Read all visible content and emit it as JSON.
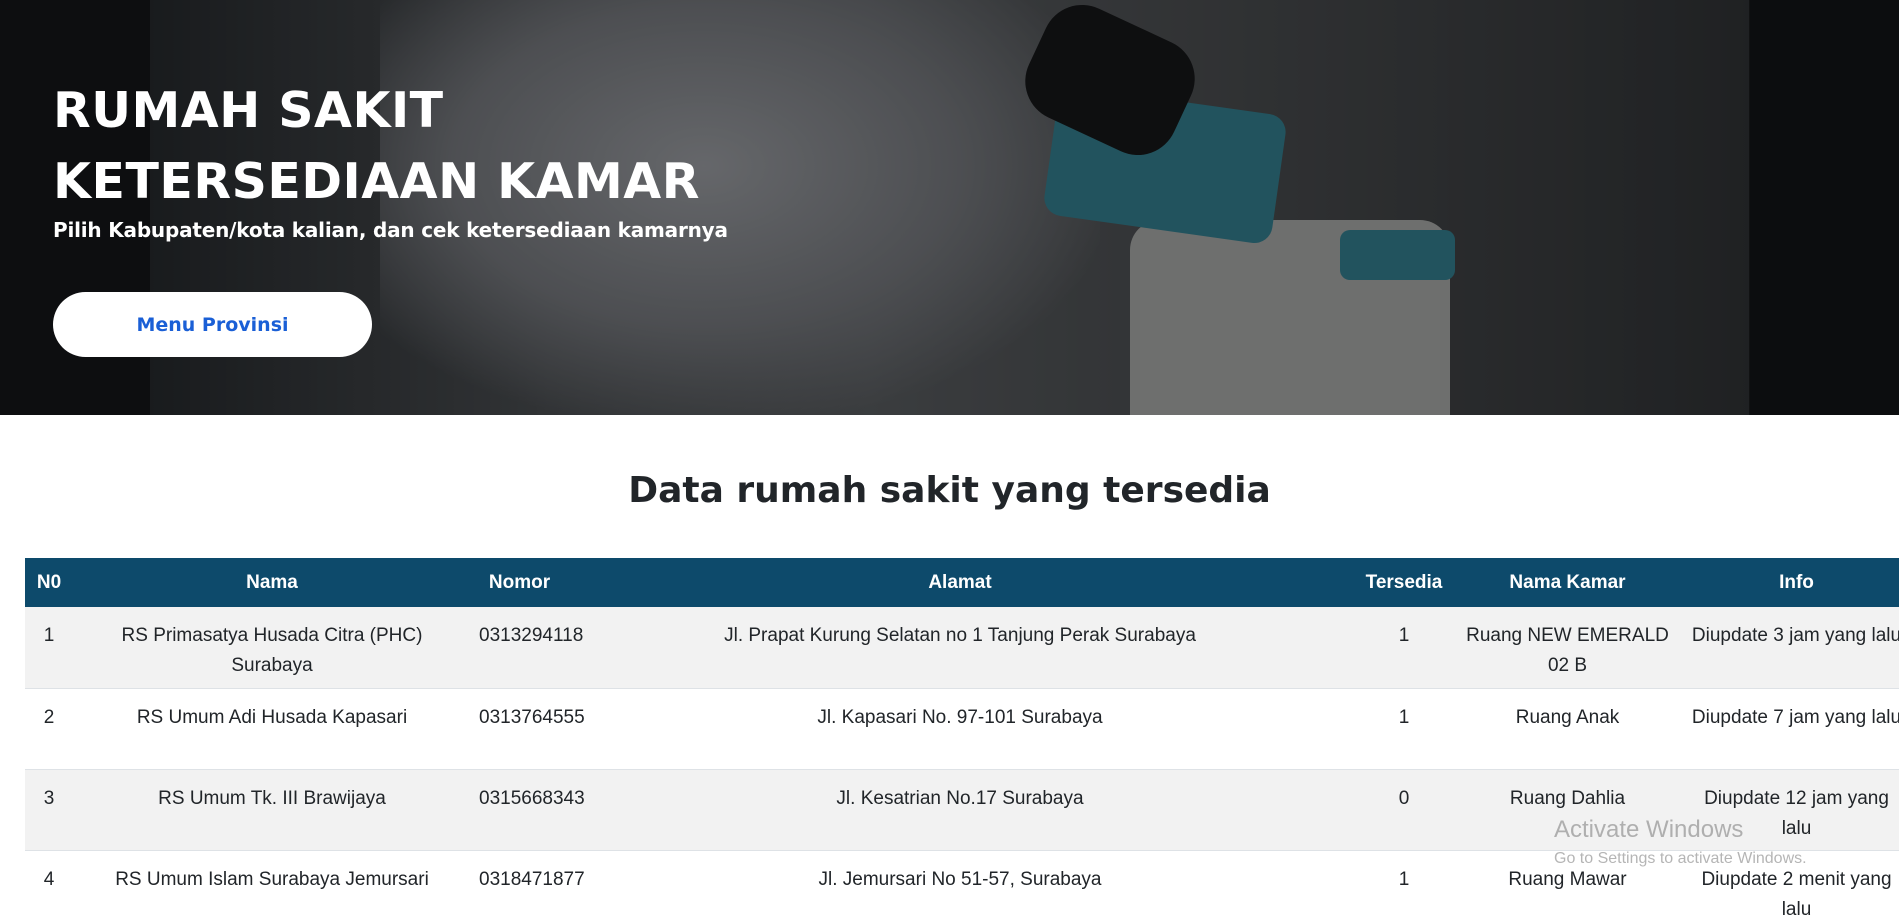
{
  "hero": {
    "title_line1": "RUMAH SAKIT",
    "title_line2": "KETERSEDIAAN KAMAR",
    "subtitle": "Pilih Kabupaten/kota kalian, dan cek ketersediaan kamarnya",
    "button_label": "Menu Provinsi"
  },
  "section": {
    "title": "Data rumah sakit yang tersedia"
  },
  "table": {
    "headers": [
      "N0",
      "Nama",
      "Nomor",
      "Alamat",
      "Tersedia",
      "Nama Kamar",
      "Info"
    ],
    "rows": [
      {
        "no": "1",
        "nama": "RS Primasatya Husada Citra (PHC) Surabaya",
        "nomor": "0313294118",
        "alamat": "Jl. Prapat Kurung Selatan no 1 Tanjung Perak Surabaya",
        "tersedia": "1",
        "kamar": "Ruang NEW EMERALD 02 B",
        "info": "Diupdate 3 jam yang lalu"
      },
      {
        "no": "2",
        "nama": "RS Umum Adi Husada Kapasari",
        "nomor": "0313764555",
        "alamat": "Jl. Kapasari No. 97-101 Surabaya",
        "tersedia": "1",
        "kamar": "Ruang Anak",
        "info": "Diupdate 7 jam yang lalu"
      },
      {
        "no": "3",
        "nama": "RS Umum Tk. III Brawijaya",
        "nomor": "0315668343",
        "alamat": "Jl. Kesatrian No.17 Surabaya",
        "tersedia": "0",
        "kamar": "Ruang Dahlia",
        "info": "Diupdate 12 jam yang lalu"
      },
      {
        "no": "4",
        "nama": "RS Umum Islam Surabaya Jemursari",
        "nomor": "0318471877",
        "alamat": "Jl. Jemursari No 51-57, Surabaya",
        "tersedia": "1",
        "kamar": "Ruang Mawar",
        "info": "Diupdate 2 menit yang lalu"
      }
    ]
  },
  "watermark": {
    "title": "Activate Windows",
    "subtitle": "Go to Settings to activate Windows."
  },
  "colors": {
    "table_header": "#0d4a6b",
    "button_text": "#1a5fd6",
    "row_stripe": "#f2f2f2"
  }
}
